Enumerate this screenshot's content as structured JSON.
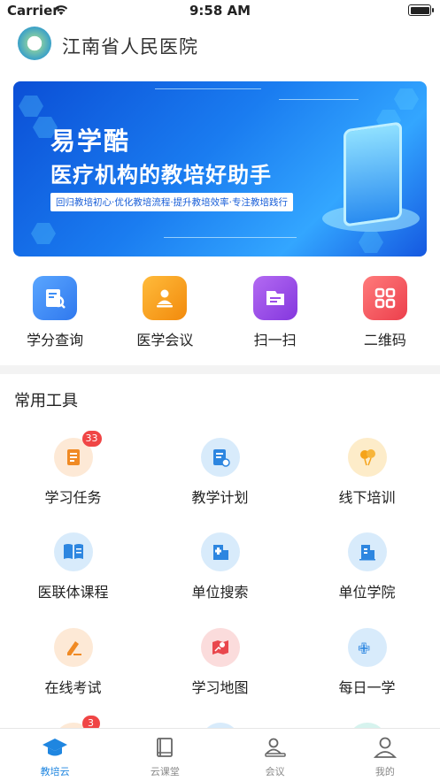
{
  "status_bar": {
    "carrier": "Carrier",
    "time": "9:58 AM"
  },
  "header": {
    "title": "江南省人民医院"
  },
  "banner": {
    "title": "易学酷",
    "subtitle": "医疗机构的教培好助手",
    "tagline": "回归教培初心·优化教培流程·提升教培效率·专注教培践行"
  },
  "quick_actions": [
    {
      "label": "学分查询",
      "icon": "credit-search-icon",
      "color": "#3d8ef5"
    },
    {
      "label": "医学会议",
      "icon": "medical-meeting-icon",
      "color": "#f7a21b"
    },
    {
      "label": "扫一扫",
      "icon": "scan-icon",
      "color": "#9b4de8"
    },
    {
      "label": "二维码",
      "icon": "qrcode-icon",
      "color": "#f04e5a"
    }
  ],
  "tools_section": {
    "title": "常用工具",
    "items": [
      {
        "label": "学习任务",
        "icon": "study-task-icon",
        "badge": "33"
      },
      {
        "label": "教学计划",
        "icon": "teaching-plan-icon",
        "badge": ""
      },
      {
        "label": "线下培训",
        "icon": "offline-training-icon",
        "badge": ""
      },
      {
        "label": "医联体课程",
        "icon": "medical-alliance-course-icon",
        "badge": ""
      },
      {
        "label": "单位搜索",
        "icon": "unit-search-icon",
        "badge": ""
      },
      {
        "label": "单位学院",
        "icon": "unit-college-icon",
        "badge": ""
      },
      {
        "label": "在线考试",
        "icon": "online-exam-icon",
        "badge": ""
      },
      {
        "label": "学习地图",
        "icon": "study-map-icon",
        "badge": ""
      },
      {
        "label": "每日一学",
        "icon": "daily-study-icon",
        "badge": ""
      },
      {
        "label": "",
        "icon": "partial-tool-icon",
        "badge": "3"
      }
    ]
  },
  "tabbar": {
    "tabs": [
      {
        "label": "教培云",
        "icon": "graduation-cap-icon",
        "active": true
      },
      {
        "label": "云课堂",
        "icon": "book-icon",
        "active": false
      },
      {
        "label": "会议",
        "icon": "meeting-icon",
        "active": false
      },
      {
        "label": "我的",
        "icon": "profile-icon",
        "active": false
      }
    ]
  },
  "colors": {
    "accent": "#1f86e0",
    "badge": "#f04545"
  }
}
